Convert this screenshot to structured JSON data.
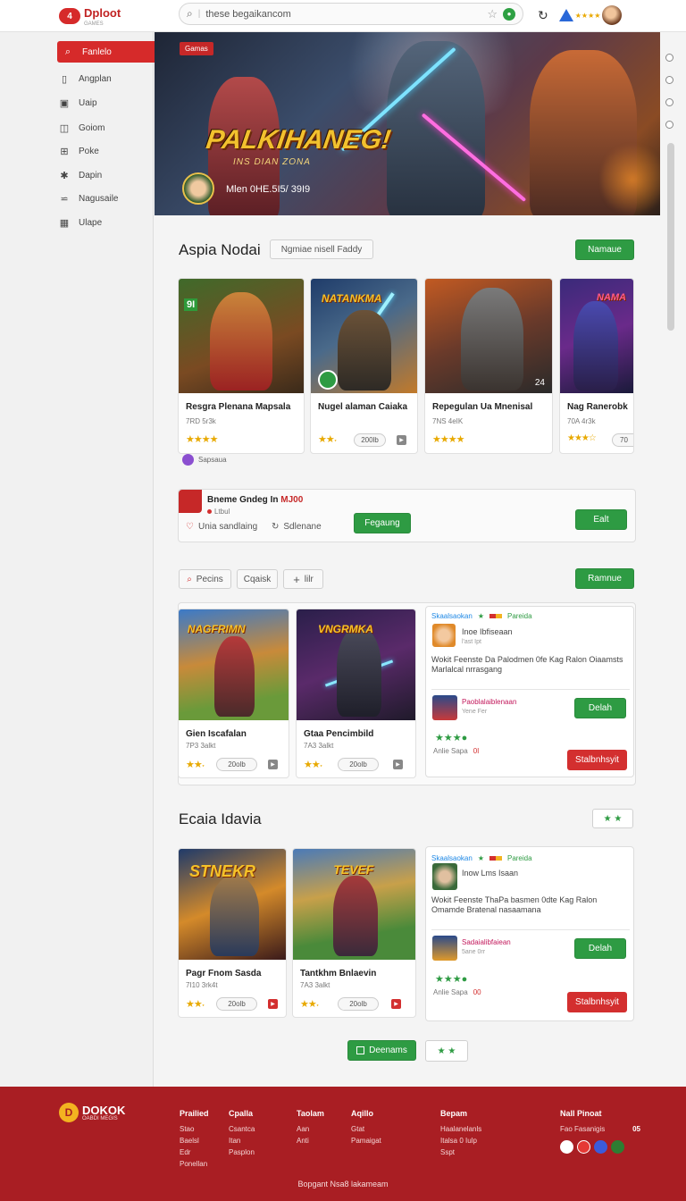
{
  "header": {
    "logo_badge": "4",
    "logo_text": "Dploot",
    "logo_sub": "GAMES",
    "search_value": "these begaikancom",
    "rating_stars": "★★★★"
  },
  "sidebar": {
    "items": [
      {
        "label": "Fanlelo",
        "icon": "search-icon"
      },
      {
        "label": "Angplan",
        "icon": "book-icon"
      },
      {
        "label": "Uaip",
        "icon": "box-icon"
      },
      {
        "label": "Goiom",
        "icon": "layers-icon"
      },
      {
        "label": "Poke",
        "icon": "gamepad-icon"
      },
      {
        "label": "Dapin",
        "icon": "star-icon"
      },
      {
        "label": "Nagusaile",
        "icon": "sliders-icon"
      },
      {
        "label": "Ulape",
        "icon": "grid-icon"
      }
    ]
  },
  "hero": {
    "tag": "Gamas",
    "title": "PALKIHANEG!",
    "subtitle": "INS DIAN ZONA",
    "meta": "Mlen 0HE.5I5/ 39I9"
  },
  "section1": {
    "title": "Aspia Nodai",
    "filter": "Ngmiae nisell Faddy",
    "action": "Namaue",
    "cards": [
      {
        "name": "Resgra Plenana Mapsala",
        "meta": "7RD 5r3k",
        "stars": "★★★★",
        "art": "9I"
      },
      {
        "name": "Nugel alaman Caiaka",
        "meta": "",
        "stars": "★★˖",
        "price": "200lb",
        "art": "NATANKMA"
      },
      {
        "name": "Repegulan Ua Mnenisal",
        "meta": "7NS 4eIK",
        "stars": "★★★★",
        "art": "24"
      },
      {
        "name": "Nag Ranerobk",
        "meta": "70A 4r3k",
        "stars": "★★★☆",
        "price": "70",
        "art": "NAMA"
      }
    ],
    "note": "Sapsaua"
  },
  "promo": {
    "title": "Bneme Gndeg In",
    "price": "MJ00",
    "meta": "Ltbul",
    "like": "Unia sandlaing",
    "share": "Sdlenane",
    "mid_btn": "Fegaung",
    "right_btn": "Ealt"
  },
  "toolbar2": {
    "search": "Pecins",
    "filter": "Cqaisk",
    "add": "lilr",
    "action": "Ramnue"
  },
  "section2": {
    "cards": [
      {
        "name": "Gien Iscafalan",
        "meta": "7P3 3alkt",
        "stars": "★★˖",
        "price": "20olb",
        "art": "NAGFRIMN"
      },
      {
        "name": "Gtaa Pencimbild",
        "meta": "7A3 3alkt",
        "stars": "★★˖",
        "price": "20olb",
        "art": "VNGRMKA"
      }
    ],
    "info": {
      "brand": "Skaalsaokan",
      "brand2": "Pareida",
      "name": "Inoe Ibfiseaan",
      "meta": "l'ast Ipt",
      "desc": "Wokit Feenste Da Palodmen 0fe Kag Ralon Oiaamsts Marlalcal nrrasgang",
      "item": "Paoblalaiblenaan",
      "item_meta": "Yene Fer",
      "view_btn": "Delah",
      "stars": "★★★●",
      "label": "Anlie Sapa",
      "label_num": "0I",
      "buy_btn": "Stalbnhsyit"
    }
  },
  "section3": {
    "title": "Ecaia Idavia",
    "stars": "★ ★",
    "cards": [
      {
        "name": "Pagr Fnom Sasda",
        "meta": "7I10 3rk4t",
        "stars": "★★˖",
        "price": "20olb",
        "art": "STNEKR"
      },
      {
        "name": "Tantkhm Bnlaevin",
        "meta": "7A3 3alkt",
        "stars": "★★˖",
        "price": "20olb",
        "art": "TEVEF"
      }
    ],
    "info": {
      "brand": "Skaalsaokan",
      "brand2": "Pareida",
      "name": "Inow Lms Isaan",
      "desc": "Wokit Feenste ThaPa basmen 0dte Kag Ralon Omamde Bratenal nasaamana",
      "item": "Sadaialibfaiean",
      "item_meta": "5ane 0rr",
      "view_btn": "Delah",
      "stars": "★★★●",
      "label": "Anlie Sapa",
      "label_num": "00",
      "buy_btn": "Stalbnhsyit"
    },
    "more_btn": "Deenams",
    "more_stars": "★ ★"
  },
  "footer": {
    "logo": "DOKOK",
    "logo_sub": "OABDI MEGIS",
    "cols": [
      {
        "head": "Prailied",
        "items": [
          "Stao",
          "Baelsl",
          "Edr",
          "Ponellan"
        ]
      },
      {
        "head": "Cpalla",
        "items": [
          "Csantca",
          "Itan",
          "Pasplon"
        ]
      },
      {
        "head": "Taolam",
        "items": [
          "Aan",
          "Anti"
        ]
      },
      {
        "head": "Aqillo",
        "items": [
          "Gtat",
          "Pamaigat"
        ]
      },
      {
        "head": "Bepam",
        "items": [
          "Haalanelanls",
          "Italsa 0 Iulp",
          "Sspt"
        ]
      },
      {
        "head": "Nall Pinoat",
        "items": [
          "Fao Fasanigis"
        ],
        "badge": "05"
      }
    ],
    "copyright": "Bopgant Nsa8 lakameam"
  }
}
